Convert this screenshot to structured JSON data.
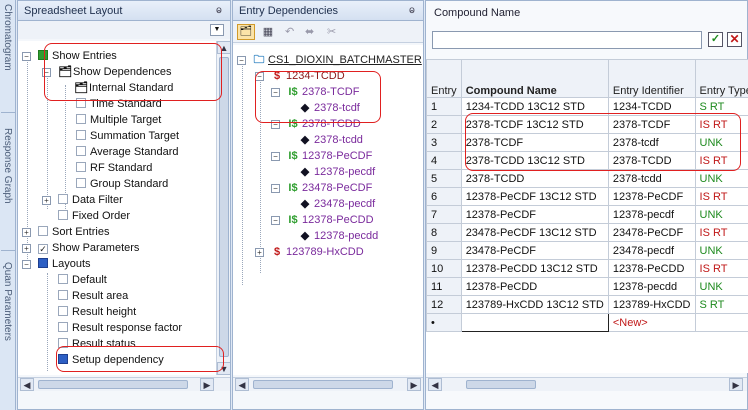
{
  "side_tabs": [
    "Chromatogram",
    "Response Graph",
    "Quan Parameters"
  ],
  "layout_panel": {
    "title": "Spreadsheet Layout",
    "items": [
      {
        "label": "Show Entries"
      },
      {
        "label": "Show Dependences"
      },
      {
        "label": "Internal Standard"
      },
      {
        "label": "Time Standard"
      },
      {
        "label": "Multiple Target"
      },
      {
        "label": "Summation Target"
      },
      {
        "label": "Average Standard"
      },
      {
        "label": "RF Standard"
      },
      {
        "label": "Group Standard"
      },
      {
        "label": "Data Filter"
      },
      {
        "label": "Fixed Order"
      },
      {
        "label": "Sort Entries"
      },
      {
        "label": "Show Parameters"
      },
      {
        "label": "Layouts"
      },
      {
        "label": "Default"
      },
      {
        "label": "Result area"
      },
      {
        "label": "Result height"
      },
      {
        "label": "Result response factor"
      },
      {
        "label": "Result status"
      },
      {
        "label": "Setup dependency"
      }
    ]
  },
  "dependencies_panel": {
    "title": "Entry Dependencies",
    "root": "CS1_DIOXIN_BATCHMASTER",
    "nodes": [
      {
        "prefix": "$",
        "label": "1234-TCDD"
      },
      {
        "prefix": "I$",
        "label": "2378-TCDF"
      },
      {
        "prefix": "◆",
        "label": "2378-tcdf"
      },
      {
        "prefix": "I$",
        "label": "2378-TCDD"
      },
      {
        "prefix": "◆",
        "label": "2378-tcdd"
      },
      {
        "prefix": "I$",
        "label": "12378-PeCDF"
      },
      {
        "prefix": "◆",
        "label": "12378-pecdf"
      },
      {
        "prefix": "I$",
        "label": "23478-PeCDF"
      },
      {
        "prefix": "◆",
        "label": "23478-pecdf"
      },
      {
        "prefix": "I$",
        "label": "12378-PeCDD"
      },
      {
        "prefix": "◆",
        "label": "12378-pecdd"
      },
      {
        "prefix": "$",
        "label": "123789-HxCDD"
      }
    ]
  },
  "grid_panel": {
    "filter_label": "Compound Name",
    "filter_value": "",
    "headers": [
      "Entry",
      "Compound Name",
      "Entry Identifier",
      "Entry Type"
    ],
    "rows": [
      {
        "n": "1",
        "name": "1234-TCDD 13C12 STD",
        "id": "1234-TCDD",
        "type": "S RT",
        "color": "green"
      },
      {
        "n": "2",
        "name": "2378-TCDF 13C12 STD",
        "id": "2378-TCDF",
        "type": "IS RT",
        "color": "red"
      },
      {
        "n": "3",
        "name": "2378-TCDF",
        "id": "2378-tcdf",
        "type": "UNK",
        "color": "green"
      },
      {
        "n": "4",
        "name": "2378-TCDD 13C12 STD",
        "id": "2378-TCDD",
        "type": "IS RT",
        "color": "red"
      },
      {
        "n": "5",
        "name": "2378-TCDD",
        "id": "2378-tcdd",
        "type": "UNK",
        "color": "green"
      },
      {
        "n": "6",
        "name": "12378-PeCDF 13C12 STD",
        "id": "12378-PeCDF",
        "type": "IS RT",
        "color": "red"
      },
      {
        "n": "7",
        "name": "12378-PeCDF",
        "id": "12378-pecdf",
        "type": "UNK",
        "color": "green"
      },
      {
        "n": "8",
        "name": "23478-PeCDF 13C12 STD",
        "id": "23478-PeCDF",
        "type": "IS RT",
        "color": "red"
      },
      {
        "n": "9",
        "name": "23478-PeCDF",
        "id": "23478-pecdf",
        "type": "UNK",
        "color": "green"
      },
      {
        "n": "10",
        "name": "12378-PeCDD 13C12 STD",
        "id": "12378-PeCDD",
        "type": "IS RT",
        "color": "red"
      },
      {
        "n": "11",
        "name": "12378-PeCDD",
        "id": "12378-pecdd",
        "type": "UNK",
        "color": "green"
      },
      {
        "n": "12",
        "name": "123789-HxCDD 13C12 STD",
        "id": "123789-HxCDD",
        "type": "S RT",
        "color": "green"
      }
    ],
    "new_row_marker": "•",
    "new_row_label": "<New>"
  },
  "colors": {
    "accent": "#2d5fc4",
    "highlight": "#e02020",
    "dependency": "#7a2a9c",
    "root_node": "#8b1a1a"
  }
}
